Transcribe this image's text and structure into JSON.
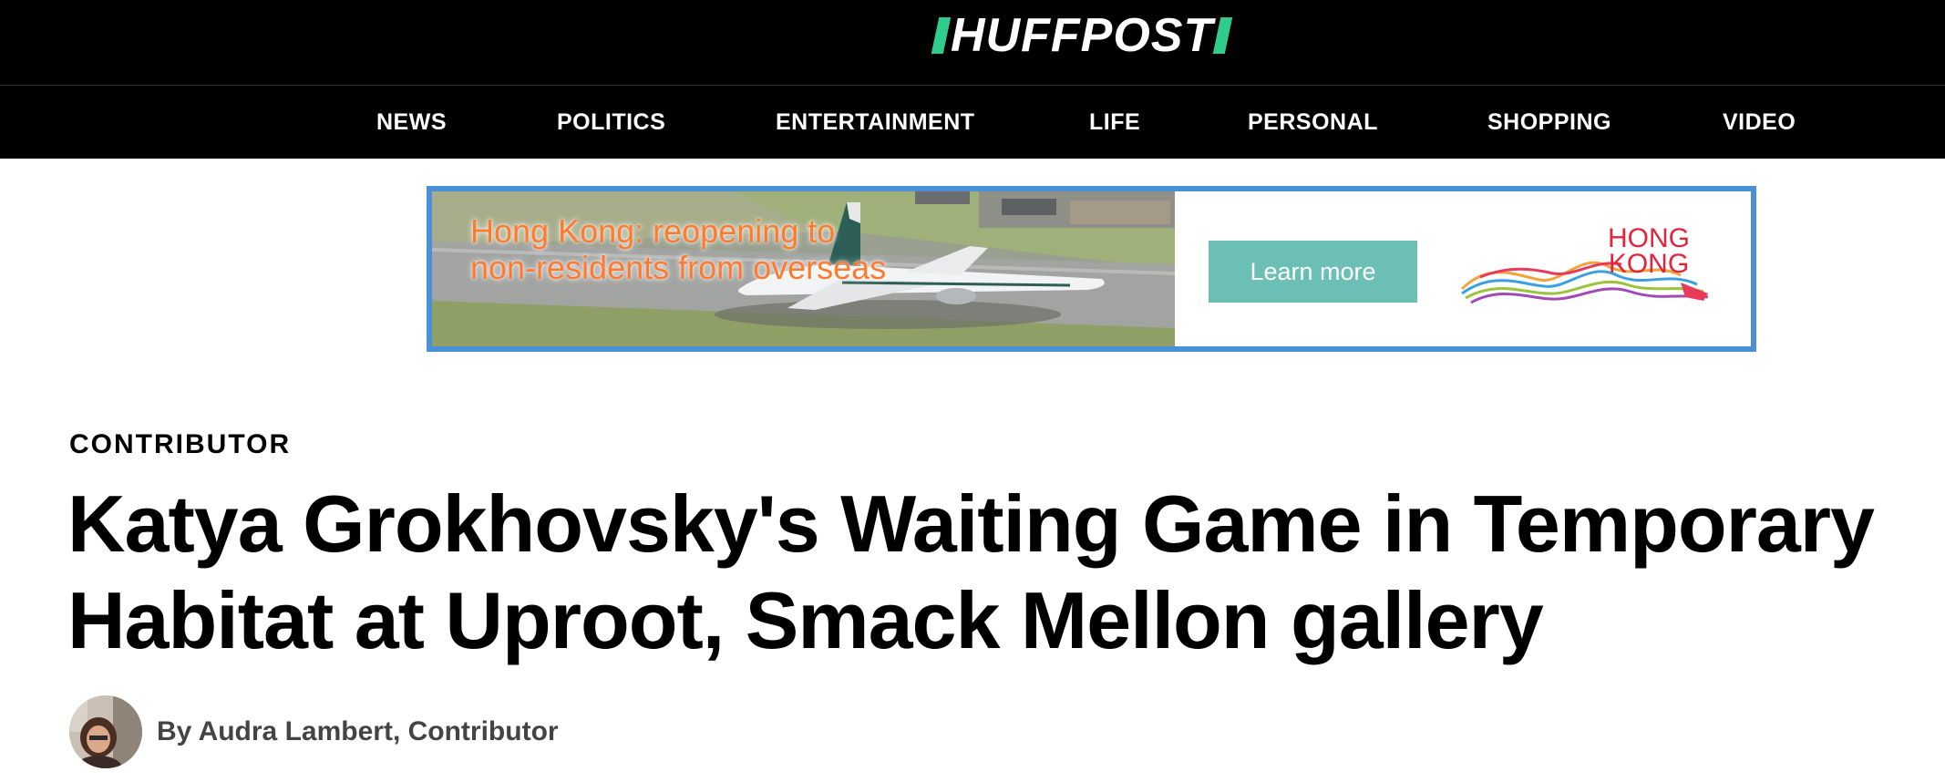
{
  "header": {
    "logo_text": "HUFFPOST",
    "logo_accent": "#2fcc8e",
    "background": "#000000"
  },
  "nav": {
    "items": [
      {
        "label": "NEWS"
      },
      {
        "label": "POLITICS"
      },
      {
        "label": "ENTERTAINMENT"
      },
      {
        "label": "LIFE"
      },
      {
        "label": "PERSONAL"
      },
      {
        "label": "SHOPPING"
      },
      {
        "label": "VIDEO"
      }
    ]
  },
  "ad": {
    "headline": "Hong Kong: reopening to non-residents from overseas",
    "cta_label": "Learn more",
    "brand_line1": "HONG",
    "brand_line2": "KONG",
    "border_color": "#4a8fd8",
    "cta_color": "#6cbfb4",
    "headline_color": "#ff7a2e",
    "brand_color": "#e6233c"
  },
  "article": {
    "kicker": "CONTRIBUTOR",
    "title": "Katya Grokhovsky's Waiting Game in Temporary Habitat at Uproot, Smack Mellon gallery",
    "byline": "By Audra Lambert, Contributor"
  }
}
